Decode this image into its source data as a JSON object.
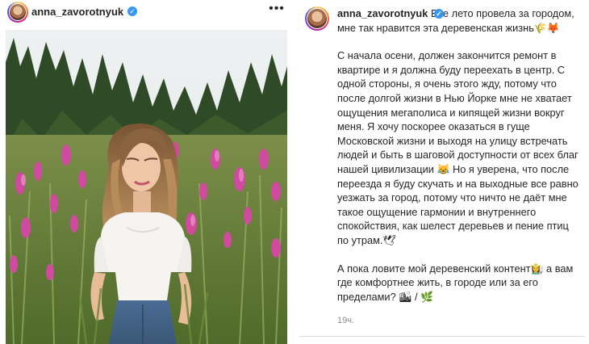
{
  "post": {
    "username": "anna_zavorotnyuk",
    "verified_icon": "verified-badge-icon",
    "more_icon": "more-options-icon",
    "more_label": "•••"
  },
  "caption": {
    "username": "anna_zavorotnyuk",
    "paragraph1": "Все лето провела за городом, мне так нравится эта деревенская жизнь🌾🦊",
    "paragraph2": "С начала осени, должен закончится ремонт в квартире и я должна буду переехать в центр. С одной стороны, я очень этого жду, потому что после долгой жизни в Нью Йорке мне не хватает ощущения мегаполиса и кипящей жизни вокруг меня. Я хочу поскорее оказаться в гуще Московской жизни и выходя на улицу встречать людей и быть в шаговой доступности от всех благ нашей цивилизации 😹  Но я уверена, что после переезда я буду скучать и на выходные все равно уезжать за город, потому что ничто не даёт мне такое ощущение гармонии и внутреннего спокойствия, как шелест деревьев и пение птиц по утрам.🕊",
    "paragraph3": "А пока ловите мой деревенский контент👩‍🌾 а вам где комфортнее жить, в городе или за его пределами? 🏙 / 🌿",
    "timestamp": "19ч."
  },
  "colors": {
    "text": "#262626",
    "muted": "#8e8e8e",
    "verified": "#3897f0",
    "divider": "#dbdbdb"
  }
}
